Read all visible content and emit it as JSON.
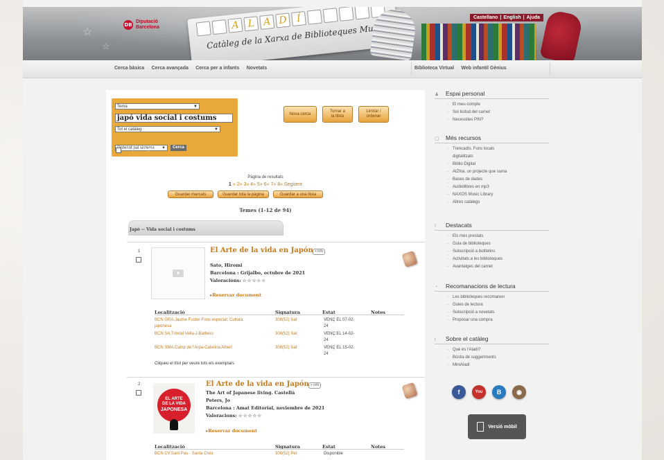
{
  "header": {
    "institution": "Diputació Barcelona",
    "institution_line1": "Diputació",
    "institution_line2": "Barcelona",
    "logo_letters": [
      "A",
      "L",
      "A",
      "D",
      "Í"
    ],
    "tagline": "Catàleg de la Xarxa de Biblioteques Municipals",
    "languages": [
      "Castellano",
      "English",
      "Ajuda"
    ]
  },
  "nav": {
    "left": [
      "Cerca bàsica",
      "Cerca avançada",
      "Cerca per a infants",
      "Novetats"
    ],
    "right": [
      "Biblioteca Virtual",
      "Web infantil Gènius"
    ]
  },
  "search": {
    "field_select": "Tema",
    "query": "japó vida social i costums",
    "scope_select": "Tot el catàleg",
    "sort_select": "Ordenat pel sistema",
    "go_label": "Cerca",
    "available_label": "exemplars disponibles",
    "buttons": {
      "new_search": "Nova cerca",
      "back_line1": "Tornar a",
      "back_line2": "la llista",
      "limit_line1": "Limitar /",
      "limit_line2": "ordenar"
    }
  },
  "pagination": {
    "label": "Pàgina de resultats",
    "pages": [
      "1",
      "2",
      "3",
      "4",
      "5",
      "6",
      "7",
      "8"
    ],
    "next": "Següent",
    "save_marked": "Guardar marcats",
    "save_page": "Guardar tota la pàgina",
    "save_list": "Guardar a una llista"
  },
  "summary": "Temes (1-12 de 94)",
  "breadcrumb": "Japó -- Vida social i costums",
  "results": [
    {
      "num": "1",
      "title": "El Arte de la vida en Japón",
      "info_label": "+ info",
      "author": "Sato, Hiromi",
      "publisher": "Barcelona : Grijalbo, octubre de 2021",
      "rating_label": "Valoracions:",
      "rating_glyphs": "☆☆☆☆☆",
      "reserve_label": "Reservar document",
      "holdings_headers": [
        "Localització",
        "Signatura",
        "Estat",
        "Notes"
      ],
      "holdings": [
        {
          "loc": "BCN GRA.Jaume Fuster-Fons especial: Cultura",
          "loc2": "japonesa",
          "sig": "308(52) Sat",
          "status": "VENÇ EL 07-02-",
          "status2": "24"
        },
        {
          "loc": "BCN SA.Trinitat Vella-J.Barbero",
          "loc2": "",
          "sig": "308(52) Sat",
          "status": "VENÇ EL 14-02-",
          "status2": "24"
        },
        {
          "loc": "BCN SMA.Camp de l'Arpa-Caterina Albert",
          "loc2": "",
          "sig": "308(52) Sat",
          "status": "VENÇ EL 15-02-",
          "status2": "24"
        }
      ],
      "click_all": "Cliqueu el títol per veure tots els exemplars"
    },
    {
      "num": "2",
      "title": "El Arte de la vida en Japón",
      "info_label": "+ info",
      "subtitle": "The Art of Japanese living. Castellà",
      "author": "Peters, Jo",
      "publisher": "Barcelona : Amat Editorial, noviembre de 2021",
      "rating_label": "Valoracions:",
      "rating_glyphs": "☆☆☆☆☆",
      "reserve_label": "Reservar document",
      "cover_text": [
        "EL ARTE",
        "DE LA VIDA",
        "JAPONESA"
      ],
      "holdings_headers": [
        "Localització",
        "Signatura",
        "Estat",
        "Notes"
      ],
      "holdings": [
        {
          "loc": "BCN CV.Sant Pau - Santa Creu",
          "loc2": "",
          "sig": "308(52) Pet",
          "status": "Disponible",
          "status2": ""
        }
      ]
    }
  ],
  "sidebar": {
    "sections": [
      {
        "title": "Espai personal",
        "items": [
          "El meu compte",
          "Sol·licitud del carnet",
          "Necessites PIN?"
        ]
      },
      {
        "title": "Més recursos",
        "items": [
          "Trencadís. Fons locals",
          "digitalitzats",
          "Biblio Digital",
          "AtZlna. un projecte que suma",
          "Bases de dades",
          "Audiollibres en mp3",
          "NAXOS Music Library",
          "Altres catàlegs"
        ]
      },
      {
        "title": "Destacats",
        "items": [
          "Els més prestats",
          "Guia de biblioteques",
          "Subscripció a butlletins",
          "Activitats a les biblioteques",
          "Avantatges del carnet"
        ]
      },
      {
        "title": "Recomanacions de lectura",
        "items": [
          "Les biblioteques recomanen",
          "Guies de lectura",
          "Subscripció a novetats",
          "Proposar una compra"
        ]
      },
      {
        "title": "Sobre el catàleg",
        "items": [
          "Què és l'Aladí?",
          "Bústia de suggeriments",
          "MiniAladí"
        ]
      }
    ],
    "social": [
      {
        "name": "facebook",
        "glyph": "f",
        "color": "#3b5998"
      },
      {
        "name": "youtube",
        "glyph": "You",
        "color": "#c4302b"
      },
      {
        "name": "blogger",
        "glyph": "B",
        "color": "#2a7ac0"
      },
      {
        "name": "instagram",
        "glyph": "◉",
        "color": "#8a6a4a"
      }
    ],
    "mobile_label": "Versió mòbil"
  }
}
